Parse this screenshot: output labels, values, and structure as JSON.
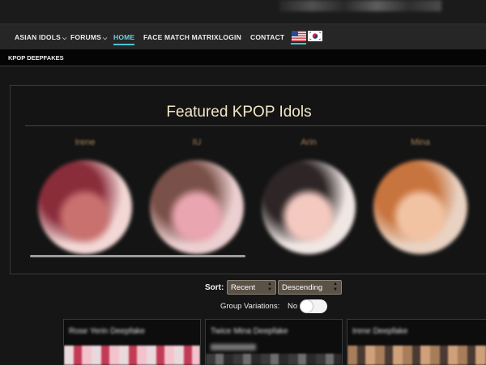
{
  "nav": {
    "items": [
      {
        "label": "ASIAN IDOLS",
        "has_caret": true
      },
      {
        "label": "FORUMS",
        "has_caret": true
      },
      {
        "label": "HOME",
        "active": true
      },
      {
        "label": "FACE MATCH MATRIX"
      },
      {
        "label": "LOGIN"
      },
      {
        "label": "CONTACT"
      }
    ],
    "caret_icon": "chevron-down-icon",
    "flags": [
      "us-flag-icon",
      "korea-flag-icon"
    ],
    "accent_color": "#4cc3d6"
  },
  "subbar": {
    "title": "KPOP DEEPFAKES"
  },
  "featured": {
    "title": "Featured KPOP Idols",
    "idols": [
      {
        "name": "Irene",
        "colors": [
          "#f2d7d5",
          "#8a2d3b",
          "#c8716f"
        ]
      },
      {
        "name": "IU",
        "colors": [
          "#eccfd0",
          "#7a5149",
          "#e9a5b0"
        ]
      },
      {
        "name": "Arin",
        "colors": [
          "#f0e7e4",
          "#2d2526",
          "#f3c9c0"
        ]
      },
      {
        "name": "Mina",
        "colors": [
          "#e9d2c2",
          "#c8743f",
          "#f2c3a3"
        ]
      }
    ]
  },
  "sort": {
    "label": "Sort:",
    "order_by": "Recent",
    "direction": "Descending",
    "group_variations_label": "Group Variations:",
    "group_variations_value": "No"
  },
  "cards": [
    {
      "title": "Rose Yerin Deepfake",
      "thumb": [
        "#e9d9dc",
        "#c23b55",
        "#f3c3cd"
      ]
    },
    {
      "title": "Twice Mina Deepfake",
      "thumb": [
        "#3a3a3a",
        "#6d6d6d",
        "#2a2a2a"
      ]
    },
    {
      "title": "Irene Deepfake",
      "thumb": [
        "#a87d5b",
        "#4a3a33",
        "#d0a07a"
      ]
    }
  ]
}
